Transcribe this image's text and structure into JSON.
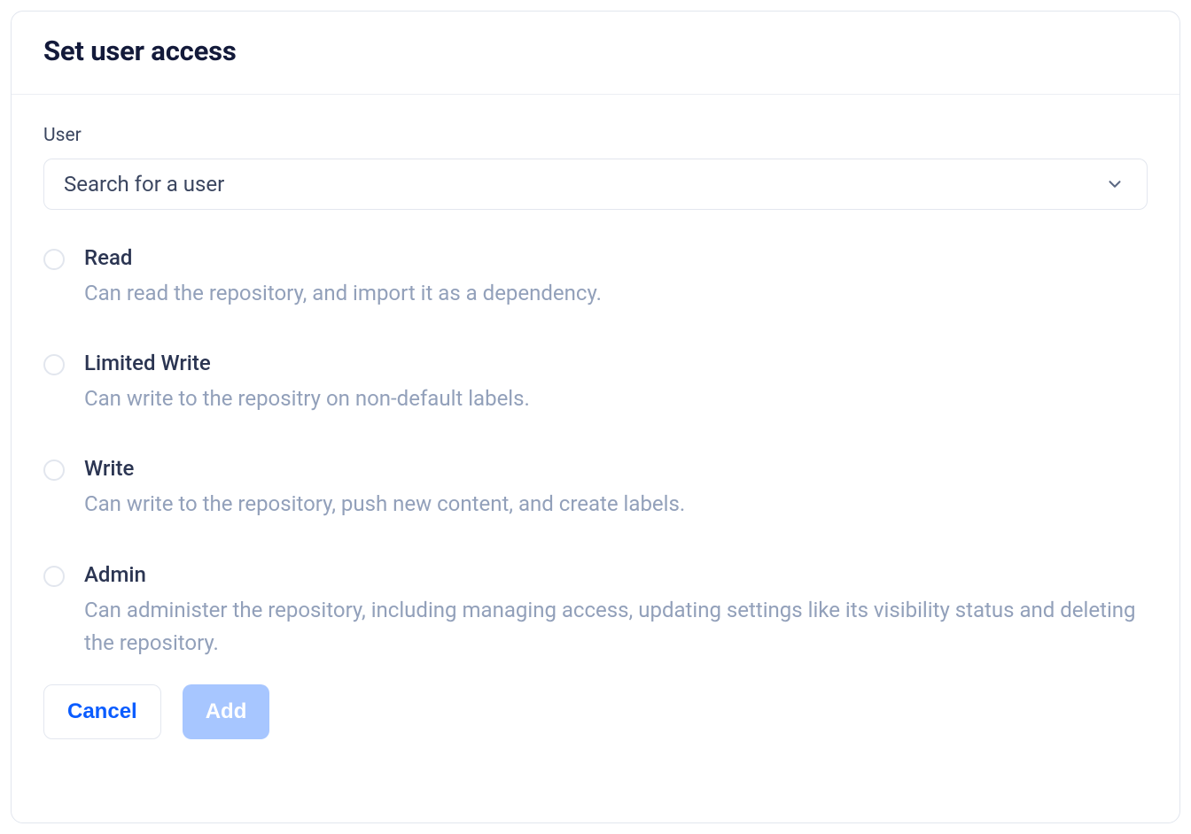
{
  "modal": {
    "title": "Set user access"
  },
  "form": {
    "user_label": "User",
    "user_placeholder": "Search for a user"
  },
  "roles": [
    {
      "title": "Read",
      "description": "Can read the repository, and import it as a dependency."
    },
    {
      "title": "Limited Write",
      "description": "Can write to the repositry on non-default labels."
    },
    {
      "title": "Write",
      "description": "Can write to the repository, push new content, and create labels."
    },
    {
      "title": "Admin",
      "description": "Can administer the repository, including managing access, updating settings like its visibility status and deleting the repository."
    }
  ],
  "buttons": {
    "cancel": "Cancel",
    "add": "Add"
  }
}
